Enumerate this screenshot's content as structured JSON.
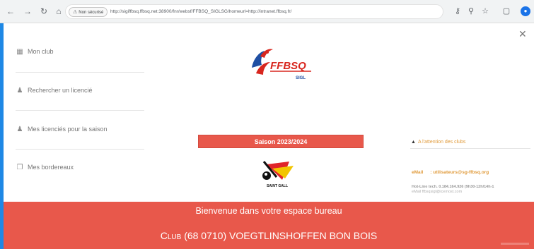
{
  "browser": {
    "security_label": "Non sécurisé",
    "url": "http://sigiffbsq.ffbsq.net:38900/fnr/websf/FFBSQ_SIGLSG/homeurl=http://intranet.ffbsq.fr/",
    "icons": [
      "back-icon",
      "forward-icon",
      "reload-icon",
      "home-icon",
      "warning-icon",
      "key-icon",
      "zoom-icon",
      "star-icon",
      "extensions-icon",
      "profile-icon"
    ]
  },
  "sidebar": {
    "items": [
      {
        "label": "Mon club",
        "icon": "club-icon"
      },
      {
        "label": "Rechercher un licencié",
        "icon": "person-icon"
      },
      {
        "label": "Mes licenciés pour la saison",
        "icon": "group-icon"
      },
      {
        "label": "Mes bordereaux",
        "icon": "documents-icon"
      }
    ]
  },
  "logo": {
    "text": "FFBSQ",
    "subtext": "SIGL"
  },
  "saison": {
    "label": "Saison 2023/2024"
  },
  "club_logo": {
    "text": "SAINT GALL"
  },
  "right_panel": {
    "attention": "A l'attention des clubs",
    "email_label": "eMail",
    "email_value": ": utilisateurs@sg-ffbsq.org",
    "hotline": "Hot-Line tech.  0.184.164.926 (9h30-12h/14h-1",
    "hotline_email": "eMail      ffbsqsigl@icemost.com"
  },
  "banner": {
    "welcome": "Bienvenue dans votre espace bureau",
    "club_prefix": "Club",
    "club_rest": "(68 0710) VOEGTLINSHOFFEN BON BOIS"
  },
  "colors": {
    "accent": "#e8584b",
    "orange_text": "#e09a3a",
    "frame": "#1e88e5"
  }
}
